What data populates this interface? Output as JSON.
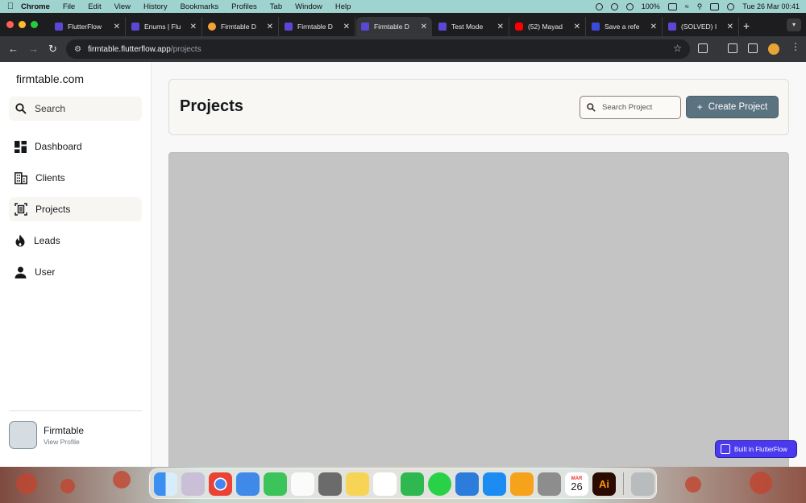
{
  "menubar": {
    "app_name": "Chrome",
    "menus": [
      "File",
      "Edit",
      "View",
      "History",
      "Bookmarks",
      "Profiles",
      "Tab",
      "Window",
      "Help"
    ],
    "battery": "100%",
    "datetime": "Tue 26 Mar  00:41"
  },
  "browser": {
    "tabs": [
      {
        "title": "FlutterFlow",
        "favicon": "flutterflow-icon"
      },
      {
        "title": "Enums | Flu",
        "favicon": "flutterflow-icon"
      },
      {
        "title": "Firmtable D",
        "favicon": "cat-icon"
      },
      {
        "title": "Firmtable D",
        "favicon": "flutterflow-icon"
      },
      {
        "title": "Firmtable D",
        "favicon": "flutterflow-icon"
      },
      {
        "title": "Test Mode",
        "favicon": "flutterflow-icon"
      },
      {
        "title": "(52) Mayad",
        "favicon": "youtube-icon"
      },
      {
        "title": "Save a refe",
        "favicon": "flutterflow-icon"
      },
      {
        "title": "(SOLVED) I",
        "favicon": "flutterflow-icon"
      }
    ],
    "active_tab_index": 4,
    "url_host": "firmtable.flutterflow.app",
    "url_path": "/projects"
  },
  "sidebar": {
    "brand": "firmtable.com",
    "search_label": "Search",
    "items": [
      {
        "label": "Dashboard",
        "icon": "dashboard-icon"
      },
      {
        "label": "Clients",
        "icon": "building-icon"
      },
      {
        "label": "Projects",
        "icon": "project-icon",
        "active": true
      },
      {
        "label": "Leads",
        "icon": "flame-icon"
      },
      {
        "label": "User",
        "icon": "person-icon"
      }
    ],
    "profile": {
      "name": "Firmtable",
      "link": "View Profile"
    }
  },
  "main": {
    "title": "Projects",
    "search_placeholder": "Search Project",
    "create_button": "Create Project"
  },
  "badge": {
    "label": "Built in FlutterFlow"
  },
  "dock": {
    "calendar_month": "MAR",
    "calendar_day": "26",
    "illustrator_label": "Ai"
  },
  "colors": {
    "accent_button": "#5b7280",
    "flutterflow_brand": "#4b39ef",
    "chrome_dark": "#35363a"
  }
}
